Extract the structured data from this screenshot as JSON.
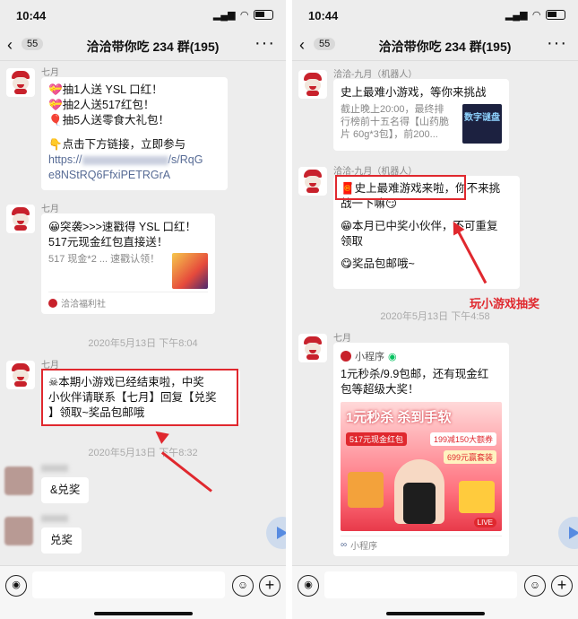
{
  "status": {
    "time": "10:44"
  },
  "nav": {
    "badge": "55",
    "title": "洽洽带你吃 234 群(195)"
  },
  "left": {
    "msg1": {
      "sender": "七月",
      "lines": [
        "💝抽1人送 YSL 口红！",
        "💝抽2人送517红包！",
        "🎈抽5人送零食大礼包！",
        "",
        "👇点击下方链接，立即参与"
      ],
      "link1": "https://",
      "link1b": "/s/RqG",
      "link2": "e8NStRQ6FfxiPETRGrA"
    },
    "msg2": {
      "sender": "七月",
      "title": "😀突袭>>>速戳得 YSL 口红！517元现金红包直接送！",
      "desc": "517 现金*2 ... 速戳认领！",
      "footer": "洽洽福利社"
    },
    "time1": "2020年5月13日 下午8:04",
    "msg3": {
      "sender": "七月",
      "lines": [
        "☠本期小游戏已经结束啦，中奖",
        "小伙伴请联系【七月】回复【兑奖",
        "】领取~奖品包邮哦"
      ]
    },
    "time2": "2020年5月13日 下午8:32",
    "msg4": {
      "text": "&兑奖"
    },
    "msg5": {
      "text": "兑奖"
    }
  },
  "right": {
    "msg1": {
      "sender": "洽洽-九月（机器人）",
      "title": "史上最难小游戏，等你来挑战",
      "desc_lines": [
        "截止晚上20:00，最终排",
        "行榜前十五名得【山药脆",
        "片 60g*3包】，前200..."
      ],
      "thumb_text": "数字谜盘"
    },
    "msg2": {
      "sender": "洽洽-九月（机器人）",
      "line1a": "🧧史上最难游戏来啦，",
      "line1b": "你不来挑",
      "line2": "战一下嘛😏",
      "line3": "",
      "line4": "😁本月已中奖小伙伴，不可重复",
      "line5": "领取",
      "line6": "",
      "line7": "😋奖品包邮哦~"
    },
    "annotation": "玩小游戏抽奖",
    "time1": "2020年5月13日 下午4:58",
    "msg3": {
      "sender": "七月",
      "app_label": "小程序",
      "text_lines": [
        "1元秒杀/9.9包邮，还有现金红",
        "包等超级大奖！"
      ],
      "banner_head": "1元秒杀 杀到手软",
      "banner_sub1": "517元现金红包",
      "banner_sub2": "199减150大额券",
      "banner_sub3": "699元赢套装",
      "banner_live": "LIVE",
      "footer": "小程序"
    }
  },
  "colors": {
    "accent_red": "#e0282e",
    "link": "#576b95",
    "chat_bg": "#ededed"
  }
}
